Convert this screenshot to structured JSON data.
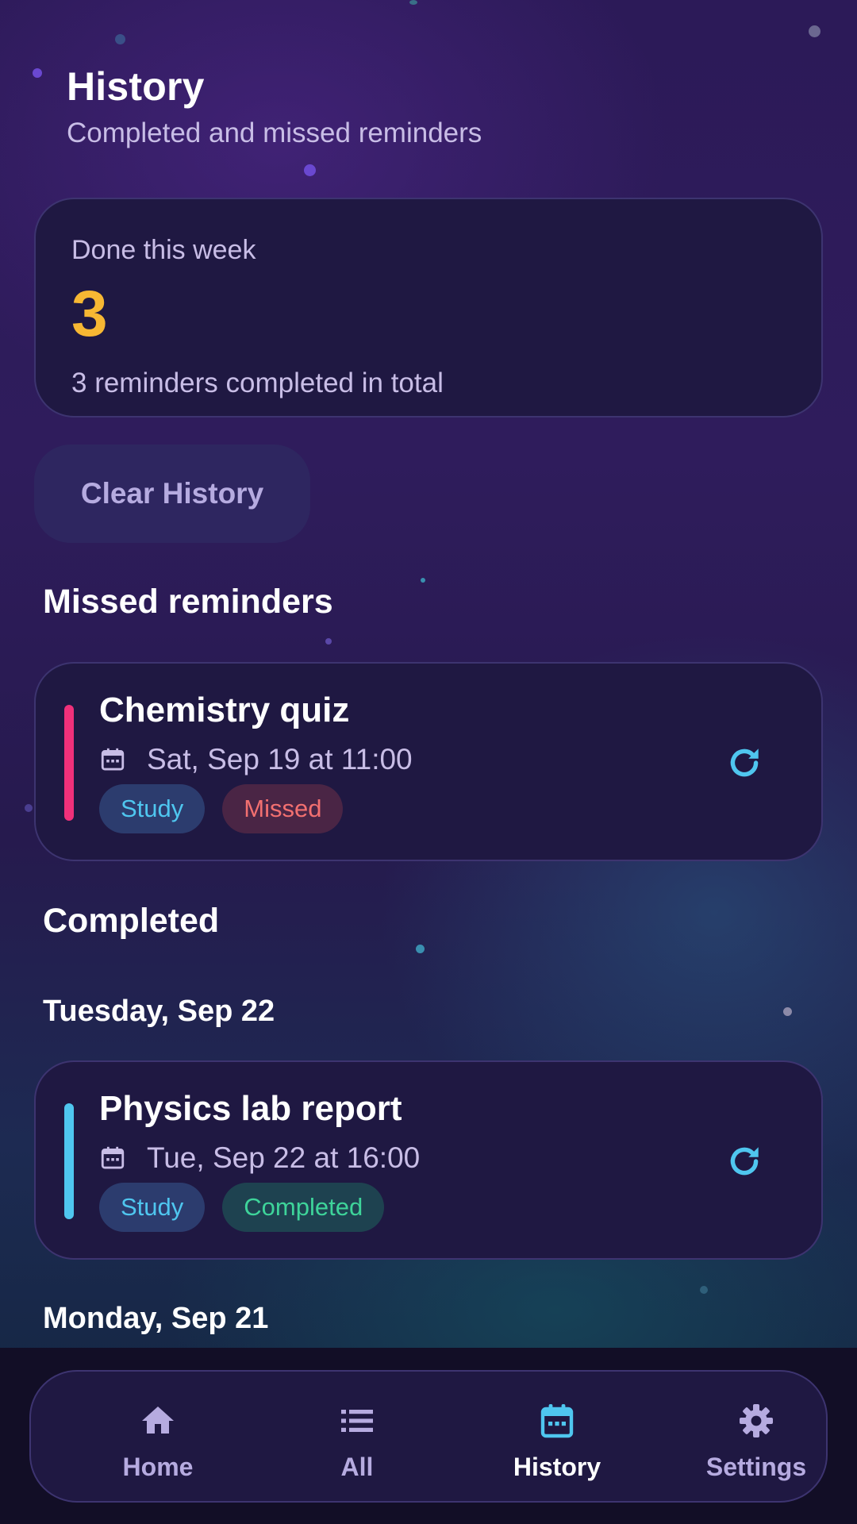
{
  "header": {
    "title": "History",
    "subtitle": "Completed and missed reminders"
  },
  "summary": {
    "label": "Done this week",
    "count": "3",
    "total_text": "3 reminders completed in total"
  },
  "clear_button": {
    "label": "Clear History"
  },
  "sections": {
    "missed_title": "Missed reminders",
    "completed_title": "Completed"
  },
  "missed": [
    {
      "title": "Chemistry quiz",
      "date": "Sat, Sep 19 at 11:00",
      "category": "Study",
      "status": "Missed",
      "accent": "#f0307a"
    }
  ],
  "completed_groups": [
    {
      "date_heading": "Tuesday, Sep 22",
      "items": [
        {
          "title": "Physics lab report",
          "date": "Tue, Sep 22 at 16:00",
          "category": "Study",
          "status": "Completed",
          "accent": "#4fc6ef"
        }
      ]
    },
    {
      "date_heading": "Monday, Sep 21",
      "items": []
    }
  ],
  "nav": {
    "items": [
      {
        "label": "Home",
        "icon": "home-icon"
      },
      {
        "label": "All",
        "icon": "list-icon"
      },
      {
        "label": "History",
        "icon": "calendar-icon",
        "active": true
      },
      {
        "label": "Settings",
        "icon": "gear-icon"
      }
    ]
  },
  "colors": {
    "accent_yellow": "#f7b733",
    "study_chip": "#4fc6ef",
    "missed_chip": "#f27070",
    "completed_chip": "#3ed49a",
    "missed_accent": "#f0307a",
    "completed_accent": "#4fc6ef"
  }
}
